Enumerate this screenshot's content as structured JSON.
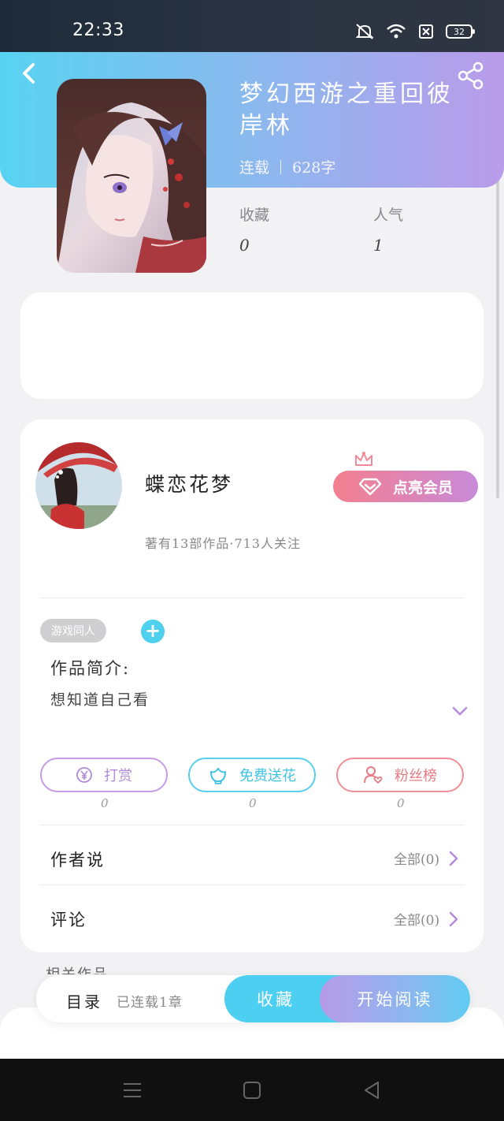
{
  "status_bar": {
    "time": "22:33",
    "battery": "32"
  },
  "book": {
    "title": "梦幻西游之重回彼岸林",
    "status": "连载",
    "word_count": "628字",
    "stats": [
      {
        "label": "收藏",
        "value": "0"
      },
      {
        "label": "人气",
        "value": "1"
      }
    ]
  },
  "author": {
    "name": "蝶恋花梦",
    "stats_line": "著有13部作品·713人关注",
    "vip_label": "点亮会员"
  },
  "tags": [
    "游戏同人"
  ],
  "add_tag_symbol": "+",
  "intro": {
    "title": "作品简介:",
    "text": "想知道自己看"
  },
  "actions": [
    {
      "label": "打赏",
      "count": "0",
      "icon": "yen-coin-icon"
    },
    {
      "label": "免费送花",
      "count": "0",
      "icon": "flower-icon"
    },
    {
      "label": "粉丝榜",
      "count": "0",
      "icon": "user-heart-icon"
    }
  ],
  "rows": [
    {
      "title": "作者说",
      "all_label": "全部(0)"
    },
    {
      "title": "评论",
      "all_label": "全部(0)"
    }
  ],
  "partial_section": "相关作品",
  "bottom_bar": {
    "toc_label": "目录",
    "toc_status": "已连载1章",
    "collect_label": "收藏",
    "read_label": "开始阅读"
  },
  "colors": {
    "cyan": "#4dcff1",
    "purple": "#b79be8",
    "pink": "#f47f8f"
  }
}
